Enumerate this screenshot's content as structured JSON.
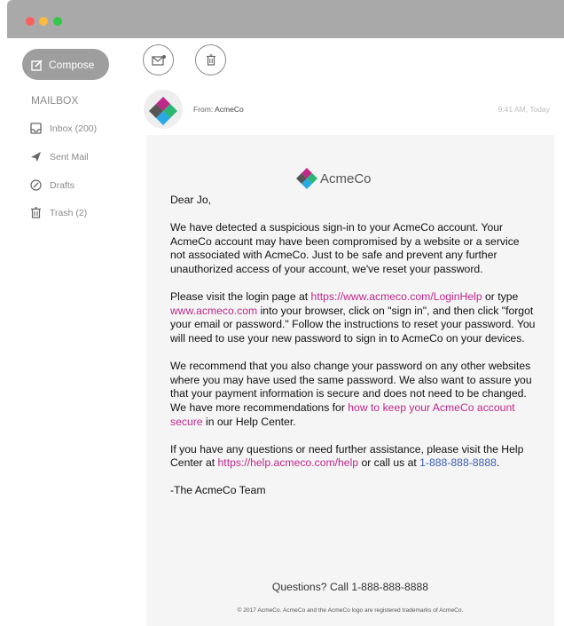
{
  "window": {
    "controls": [
      "close",
      "minimize",
      "maximize"
    ],
    "colors": {
      "close": "#fc605c",
      "minimize": "#fdbc40",
      "maximize": "#34c84a"
    }
  },
  "sidebar": {
    "compose_label": "Compose",
    "mailbox_title": "MAILBOX",
    "items": [
      {
        "label": "Inbox (200)",
        "icon": "inbox-icon"
      },
      {
        "label": "Sent Mail",
        "icon": "send-icon"
      },
      {
        "label": "Drafts",
        "icon": "draft-icon"
      },
      {
        "label": "Trash (2)",
        "icon": "trash-icon"
      }
    ]
  },
  "toolbar": {
    "buttons": [
      {
        "icon": "mail-icon"
      },
      {
        "icon": "trash-icon"
      }
    ]
  },
  "message": {
    "from_label": "From:",
    "from_name": "AcmeCo",
    "timestamp": "9:41 AM, Today",
    "brand": "AcmeCo",
    "greeting": "Dear Jo,",
    "p1": "We have detected a suspicious sign-in to your AcmeCo account. Your AcmeCo account may have been compromised by a website or a service not associated with AcmeCo. Just to be safe and prevent any further unauthorized access of your account, we've reset your password.",
    "p2_a": "Please visit the login page at ",
    "p2_link1": "https://www.acmeco.com/LoginHelp",
    "p2_b": " or type ",
    "p2_link2": "www.acmeco.com",
    "p2_c": " into your browser, click on \"sign in\", and then click \"forgot your email or password.\" Follow the instructions to reset your password. You will need to use your new password to sign in to AcmeCo on your devices.",
    "p3_a": "We recommend that you also change your password on any other websites where you may have used the same password. We also want to assure you that your payment information is secure and does not need to be changed. We have more recommendations for ",
    "p3_link": "how to keep your AcmeCo account secure",
    "p3_b": " in our Help Center.",
    "p4_a": "If you have any questions or need further assistance, please visit the Help Center at ",
    "p4_link": "https://help.acmeco.com/help",
    "p4_b": " or call us at ",
    "p4_phone": "1-888-888-8888",
    "p4_c": ".",
    "signoff": "-The AcmeCo Team",
    "questions": "Questions? Call 1-888-888-8888",
    "footer": "© 2017 AcmeCo. AcmeCo and the AcmeCo logo are registered trademarks of AcmeCo."
  },
  "colors": {
    "link_pink": "#c0278a",
    "link_blue": "#3b5fb3",
    "compose_bg": "#9e9e9e",
    "titlebar": "#a9a9a9",
    "body_bg": "#f5f5f5"
  }
}
